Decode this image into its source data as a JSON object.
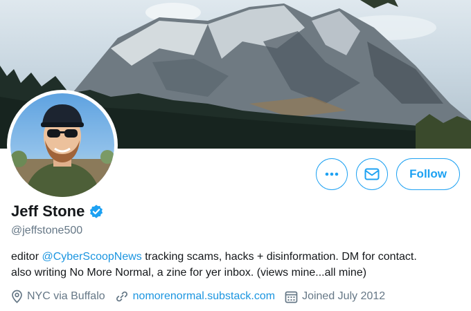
{
  "profile": {
    "name": "Jeff Stone",
    "handle": "@jeffstone500",
    "verified": true,
    "bio": {
      "prefix": "editor ",
      "mention": "@CyberScoopNews",
      "line1_rest": " tracking scams, hacks + disinformation. DM for contact.",
      "line2": "also writing No More Normal, a zine for yer inbox. (views mine...all mine)"
    },
    "location": "NYC via Buffalo",
    "website": "nomorenormal.substack.com",
    "joined": "Joined July 2012"
  },
  "actions": {
    "more_icon": "more-horizontal-icon",
    "message_icon": "envelope-icon",
    "follow_label": "Follow"
  },
  "colors": {
    "accent": "#1da1f2",
    "link": "#1b95e0",
    "secondary_text": "#657786",
    "primary_text": "#14171a"
  }
}
